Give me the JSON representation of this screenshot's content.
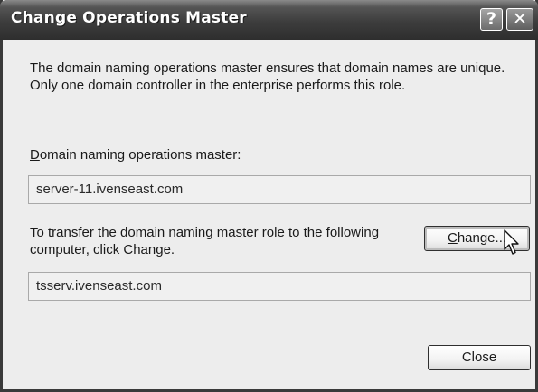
{
  "window": {
    "title": "Change Operations Master",
    "help_glyph": "?",
    "close_glyph": "✕"
  },
  "description": "The domain naming operations master ensures that domain names are unique. Only one domain controller in the enterprise performs this role.",
  "current_master": {
    "label_access_key": "D",
    "label_rest": "omain naming operations master:",
    "value": "server-11.ivenseast.com"
  },
  "transfer": {
    "label_access_key": "T",
    "label_rest": "o transfer the domain naming master role to the following computer, click Change.",
    "value": "tsserv.ivenseast.com"
  },
  "buttons": {
    "change_access_key": "C",
    "change_rest": "hange...",
    "close": "Close"
  },
  "icons": {
    "cursor": "mouse-pointer-icon"
  }
}
